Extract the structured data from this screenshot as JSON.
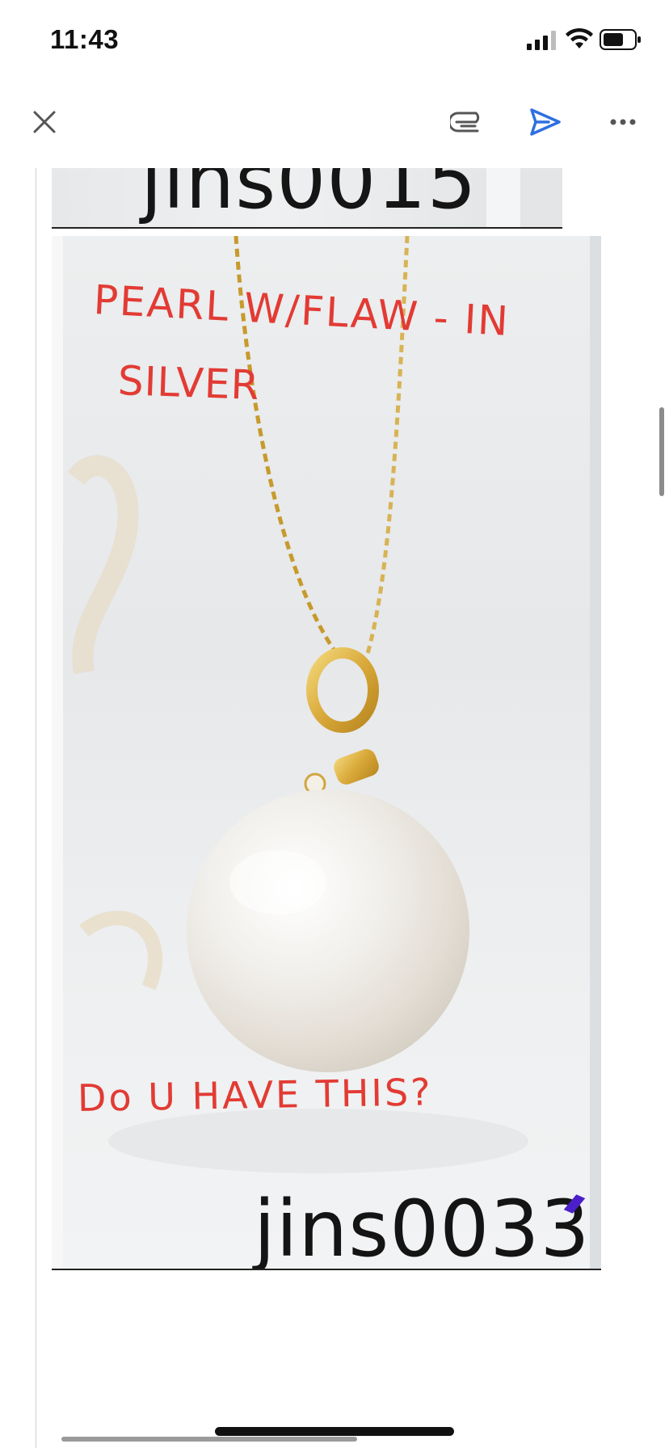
{
  "status_bar": {
    "time": "11:43"
  },
  "toolbar": {
    "close_icon": "close-icon",
    "attach_icon": "paperclip-icon",
    "send_icon": "send-icon",
    "more_icon": "more-icon",
    "send_color": "#2f6fe0"
  },
  "document": {
    "previous_image": {
      "product_code": "jins0015"
    },
    "main_image": {
      "handwritten_notes": {
        "line_1": "PEARL W/FLAW - IN",
        "line_2": "SILVER",
        "line_3": "Do U HAVE THIS?"
      },
      "product_code": "jins0033",
      "note_color": "#e23b34"
    }
  }
}
